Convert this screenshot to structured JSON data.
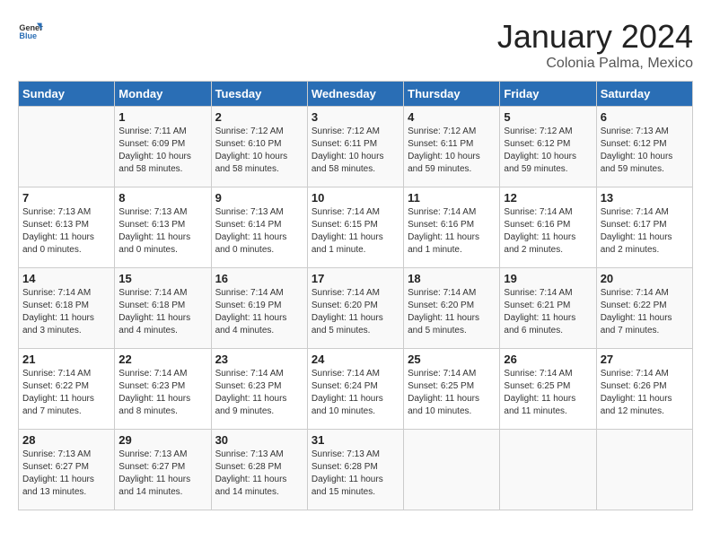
{
  "header": {
    "logo_general": "General",
    "logo_blue": "Blue",
    "month_title": "January 2024",
    "subtitle": "Colonia Palma, Mexico"
  },
  "days_of_week": [
    "Sunday",
    "Monday",
    "Tuesday",
    "Wednesday",
    "Thursday",
    "Friday",
    "Saturday"
  ],
  "weeks": [
    [
      {
        "day": "",
        "sunrise": "",
        "sunset": "",
        "daylight": ""
      },
      {
        "day": "1",
        "sunrise": "Sunrise: 7:11 AM",
        "sunset": "Sunset: 6:09 PM",
        "daylight": "Daylight: 10 hours and 58 minutes."
      },
      {
        "day": "2",
        "sunrise": "Sunrise: 7:12 AM",
        "sunset": "Sunset: 6:10 PM",
        "daylight": "Daylight: 10 hours and 58 minutes."
      },
      {
        "day": "3",
        "sunrise": "Sunrise: 7:12 AM",
        "sunset": "Sunset: 6:11 PM",
        "daylight": "Daylight: 10 hours and 58 minutes."
      },
      {
        "day": "4",
        "sunrise": "Sunrise: 7:12 AM",
        "sunset": "Sunset: 6:11 PM",
        "daylight": "Daylight: 10 hours and 59 minutes."
      },
      {
        "day": "5",
        "sunrise": "Sunrise: 7:12 AM",
        "sunset": "Sunset: 6:12 PM",
        "daylight": "Daylight: 10 hours and 59 minutes."
      },
      {
        "day": "6",
        "sunrise": "Sunrise: 7:13 AM",
        "sunset": "Sunset: 6:12 PM",
        "daylight": "Daylight: 10 hours and 59 minutes."
      }
    ],
    [
      {
        "day": "7",
        "sunrise": "Sunrise: 7:13 AM",
        "sunset": "Sunset: 6:13 PM",
        "daylight": "Daylight: 11 hours and 0 minutes."
      },
      {
        "day": "8",
        "sunrise": "Sunrise: 7:13 AM",
        "sunset": "Sunset: 6:13 PM",
        "daylight": "Daylight: 11 hours and 0 minutes."
      },
      {
        "day": "9",
        "sunrise": "Sunrise: 7:13 AM",
        "sunset": "Sunset: 6:14 PM",
        "daylight": "Daylight: 11 hours and 0 minutes."
      },
      {
        "day": "10",
        "sunrise": "Sunrise: 7:14 AM",
        "sunset": "Sunset: 6:15 PM",
        "daylight": "Daylight: 11 hours and 1 minute."
      },
      {
        "day": "11",
        "sunrise": "Sunrise: 7:14 AM",
        "sunset": "Sunset: 6:16 PM",
        "daylight": "Daylight: 11 hours and 1 minute."
      },
      {
        "day": "12",
        "sunrise": "Sunrise: 7:14 AM",
        "sunset": "Sunset: 6:16 PM",
        "daylight": "Daylight: 11 hours and 2 minutes."
      },
      {
        "day": "13",
        "sunrise": "Sunrise: 7:14 AM",
        "sunset": "Sunset: 6:17 PM",
        "daylight": "Daylight: 11 hours and 2 minutes."
      }
    ],
    [
      {
        "day": "14",
        "sunrise": "Sunrise: 7:14 AM",
        "sunset": "Sunset: 6:18 PM",
        "daylight": "Daylight: 11 hours and 3 minutes."
      },
      {
        "day": "15",
        "sunrise": "Sunrise: 7:14 AM",
        "sunset": "Sunset: 6:18 PM",
        "daylight": "Daylight: 11 hours and 4 minutes."
      },
      {
        "day": "16",
        "sunrise": "Sunrise: 7:14 AM",
        "sunset": "Sunset: 6:19 PM",
        "daylight": "Daylight: 11 hours and 4 minutes."
      },
      {
        "day": "17",
        "sunrise": "Sunrise: 7:14 AM",
        "sunset": "Sunset: 6:20 PM",
        "daylight": "Daylight: 11 hours and 5 minutes."
      },
      {
        "day": "18",
        "sunrise": "Sunrise: 7:14 AM",
        "sunset": "Sunset: 6:20 PM",
        "daylight": "Daylight: 11 hours and 5 minutes."
      },
      {
        "day": "19",
        "sunrise": "Sunrise: 7:14 AM",
        "sunset": "Sunset: 6:21 PM",
        "daylight": "Daylight: 11 hours and 6 minutes."
      },
      {
        "day": "20",
        "sunrise": "Sunrise: 7:14 AM",
        "sunset": "Sunset: 6:22 PM",
        "daylight": "Daylight: 11 hours and 7 minutes."
      }
    ],
    [
      {
        "day": "21",
        "sunrise": "Sunrise: 7:14 AM",
        "sunset": "Sunset: 6:22 PM",
        "daylight": "Daylight: 11 hours and 7 minutes."
      },
      {
        "day": "22",
        "sunrise": "Sunrise: 7:14 AM",
        "sunset": "Sunset: 6:23 PM",
        "daylight": "Daylight: 11 hours and 8 minutes."
      },
      {
        "day": "23",
        "sunrise": "Sunrise: 7:14 AM",
        "sunset": "Sunset: 6:23 PM",
        "daylight": "Daylight: 11 hours and 9 minutes."
      },
      {
        "day": "24",
        "sunrise": "Sunrise: 7:14 AM",
        "sunset": "Sunset: 6:24 PM",
        "daylight": "Daylight: 11 hours and 10 minutes."
      },
      {
        "day": "25",
        "sunrise": "Sunrise: 7:14 AM",
        "sunset": "Sunset: 6:25 PM",
        "daylight": "Daylight: 11 hours and 10 minutes."
      },
      {
        "day": "26",
        "sunrise": "Sunrise: 7:14 AM",
        "sunset": "Sunset: 6:25 PM",
        "daylight": "Daylight: 11 hours and 11 minutes."
      },
      {
        "day": "27",
        "sunrise": "Sunrise: 7:14 AM",
        "sunset": "Sunset: 6:26 PM",
        "daylight": "Daylight: 11 hours and 12 minutes."
      }
    ],
    [
      {
        "day": "28",
        "sunrise": "Sunrise: 7:13 AM",
        "sunset": "Sunset: 6:27 PM",
        "daylight": "Daylight: 11 hours and 13 minutes."
      },
      {
        "day": "29",
        "sunrise": "Sunrise: 7:13 AM",
        "sunset": "Sunset: 6:27 PM",
        "daylight": "Daylight: 11 hours and 14 minutes."
      },
      {
        "day": "30",
        "sunrise": "Sunrise: 7:13 AM",
        "sunset": "Sunset: 6:28 PM",
        "daylight": "Daylight: 11 hours and 14 minutes."
      },
      {
        "day": "31",
        "sunrise": "Sunrise: 7:13 AM",
        "sunset": "Sunset: 6:28 PM",
        "daylight": "Daylight: 11 hours and 15 minutes."
      },
      {
        "day": "",
        "sunrise": "",
        "sunset": "",
        "daylight": ""
      },
      {
        "day": "",
        "sunrise": "",
        "sunset": "",
        "daylight": ""
      },
      {
        "day": "",
        "sunrise": "",
        "sunset": "",
        "daylight": ""
      }
    ]
  ]
}
